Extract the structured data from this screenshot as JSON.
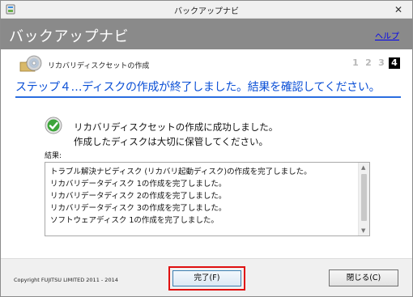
{
  "window": {
    "title": "バックアップナビ",
    "close_glyph": "✕"
  },
  "header": {
    "title": "バックアップナビ",
    "help_label": "ヘルプ"
  },
  "step": {
    "name": "リカバリディスクセットの作成",
    "numbers": [
      "1",
      "2",
      "3",
      "4"
    ],
    "active_index": 3,
    "headline": "ステップ４…ディスクの作成が終了しました。結果を確認してください。"
  },
  "message": {
    "line1": "リカバリディスクセットの作成に成功しました。",
    "line2": "作成したディスクは大切に保管してください。"
  },
  "result": {
    "label": "結果:",
    "items": [
      "トラブル解決ナビディスク (リカバリ起動ディスク)の作成を完了しました。",
      "リカバリデータディスク 1の作成を完了しました。",
      "リカバリデータディスク 2の作成を完了しました。",
      "リカバリデータディスク 3の作成を完了しました。",
      "ソフトウェアディスク 1の作成を完了しました。"
    ]
  },
  "footer": {
    "copyright": "Copyright FUJITSU LIMITED 2011 - 2014",
    "finish_label": "完了(F)",
    "close_label": "閉じる(C)"
  },
  "colors": {
    "header_bg": "#8a8a8a",
    "headline": "#0a4fd6",
    "divider": "#2a6de0",
    "highlight": "#e01010",
    "success_green": "#3da53a"
  },
  "icons": {
    "app": "app-icon",
    "step": "disc-folder-icon",
    "status": "check-circle-icon"
  }
}
